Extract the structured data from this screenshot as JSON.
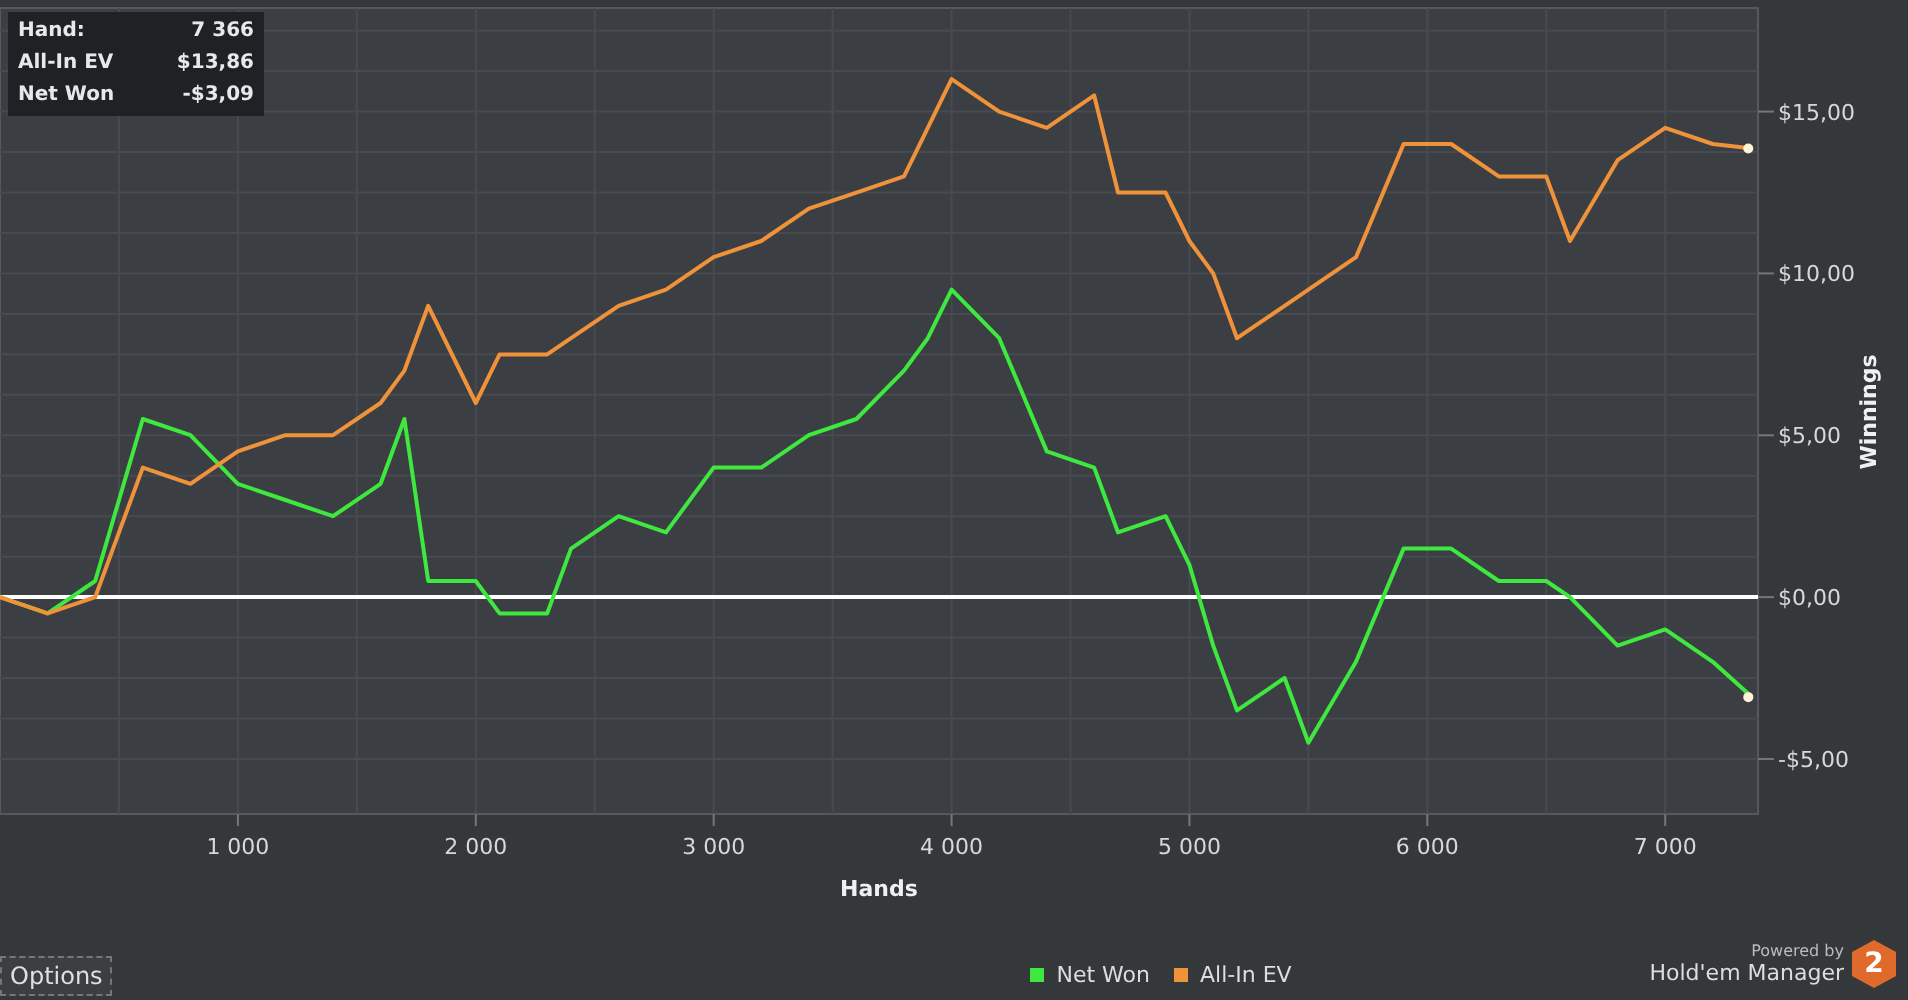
{
  "stats": [
    {
      "label": "Hand:",
      "value": "7 366"
    },
    {
      "label": "All-In EV",
      "value": "$13,86"
    },
    {
      "label": "Net Won",
      "value": "-$3,09"
    }
  ],
  "chart_data": {
    "type": "line",
    "grid": true,
    "xlabel": "Hands",
    "ylabel": "Winnings",
    "xlim": [
      0,
      7390
    ],
    "ylim": [
      -6.7,
      18.2
    ],
    "xticks": [
      {
        "value": 1000,
        "label": "1 000"
      },
      {
        "value": 2000,
        "label": "2 000"
      },
      {
        "value": 3000,
        "label": "3 000"
      },
      {
        "value": 4000,
        "label": "4 000"
      },
      {
        "value": 5000,
        "label": "5 000"
      },
      {
        "value": 6000,
        "label": "6 000"
      },
      {
        "value": 7000,
        "label": "7 000"
      }
    ],
    "yticks": [
      {
        "value": -5,
        "label": "-$5,00"
      },
      {
        "value": 0,
        "label": "$0,00"
      },
      {
        "value": 5,
        "label": "$5,00"
      },
      {
        "value": 10,
        "label": "$10,00"
      },
      {
        "value": 15,
        "label": "$15,00"
      }
    ],
    "x": [
      0,
      200,
      400,
      500,
      600,
      800,
      1000,
      1200,
      1400,
      1600,
      1700,
      1800,
      2000,
      2100,
      2300,
      2400,
      2600,
      2800,
      3000,
      3200,
      3400,
      3600,
      3800,
      3900,
      4000,
      4200,
      4400,
      4600,
      4700,
      4900,
      5000,
      5100,
      5200,
      5400,
      5500,
      5700,
      5900,
      6100,
      6300,
      6500,
      6600,
      6800,
      7000,
      7200,
      7366
    ],
    "series": [
      {
        "name": "Net Won",
        "color": "#3ee83e",
        "values": [
          0,
          -0.5,
          0.5,
          3,
          5.5,
          5,
          3.5,
          3,
          2.5,
          3.5,
          5.5,
          0.5,
          0.5,
          -0.5,
          -0.5,
          1.5,
          2.5,
          2,
          4,
          4,
          5,
          5.5,
          7,
          8,
          9.5,
          8,
          4.5,
          4,
          2,
          2.5,
          1,
          -1.5,
          -3.5,
          -2.5,
          -4.5,
          -2,
          1.5,
          1.5,
          0.5,
          0.5,
          0,
          -1.5,
          -1,
          -2,
          -3.09
        ]
      },
      {
        "name": "All-In EV",
        "color": "#f0923a",
        "values": [
          0,
          -0.5,
          0,
          2,
          4,
          3.5,
          4.5,
          5,
          5,
          6,
          7,
          9,
          6,
          7.5,
          7.5,
          8,
          9,
          9.5,
          10.5,
          11,
          12,
          12.5,
          13,
          14.5,
          16,
          15,
          14.5,
          15.5,
          12.5,
          12.5,
          11,
          10,
          8,
          9,
          9.5,
          10.5,
          14,
          14,
          13,
          13,
          11,
          13.5,
          14.5,
          14,
          13.86
        ]
      }
    ]
  },
  "options_button": "Options",
  "brand": {
    "powered_by": "Powered by",
    "name": "Hold'em Manager",
    "badge": "2"
  }
}
